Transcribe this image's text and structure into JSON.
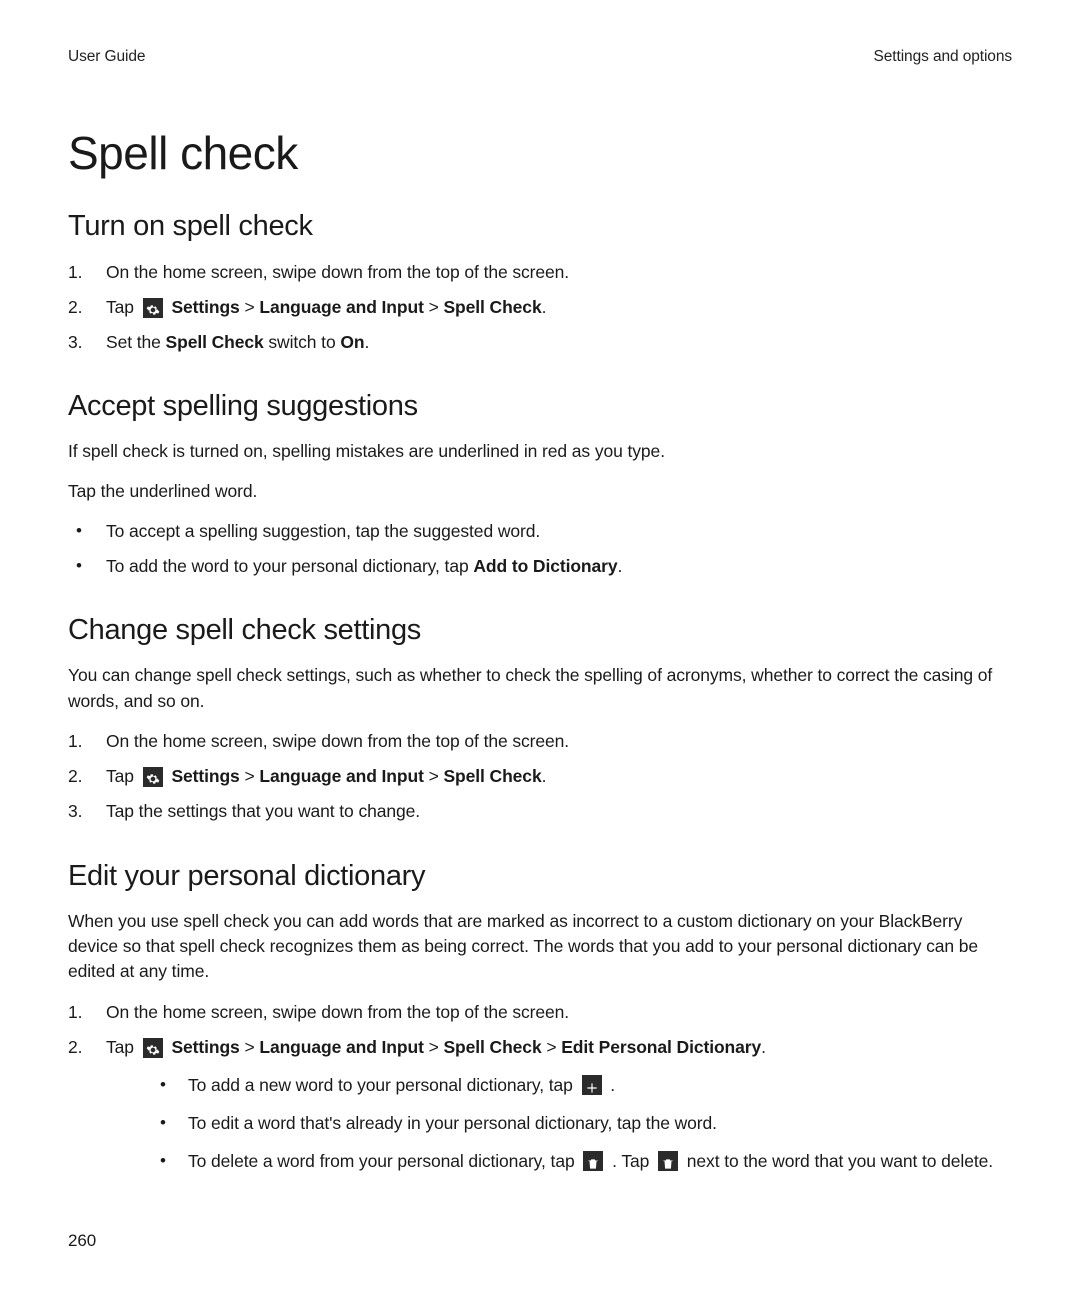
{
  "header": {
    "left": "User Guide",
    "right": "Settings and options"
  },
  "title": "Spell check",
  "page_number": "260",
  "sec1": {
    "heading": "Turn on spell check",
    "steps": {
      "s1": "On the home screen, swipe down from the top of the screen.",
      "s2": {
        "tap": "Tap ",
        "settings": "Settings",
        "gt1": " > ",
        "lai": "Language and Input",
        "gt2": " > ",
        "sc": "Spell Check",
        "dot": "."
      },
      "s3": {
        "a": "Set the ",
        "b": "Spell Check",
        "c": " switch to ",
        "d": "On",
        "e": "."
      }
    }
  },
  "sec2": {
    "heading": "Accept spelling suggestions",
    "p1": "If spell check is turned on, spelling mistakes are underlined in red as you type.",
    "p2": "Tap the underlined word.",
    "bul": {
      "b1": "To accept a spelling suggestion, tap the suggested word.",
      "b2": {
        "a": "To add the word to your personal dictionary, tap ",
        "b": "Add to Dictionary",
        "c": "."
      }
    }
  },
  "sec3": {
    "heading": "Change spell check settings",
    "p1": "You can change spell check settings, such as whether to check the spelling of acronyms, whether to correct the casing of words, and so on.",
    "steps": {
      "s1": "On the home screen, swipe down from the top of the screen.",
      "s2": {
        "tap": "Tap ",
        "settings": "Settings",
        "gt1": " > ",
        "lai": "Language and Input",
        "gt2": " > ",
        "sc": "Spell Check",
        "dot": "."
      },
      "s3": "Tap the settings that you want to change."
    }
  },
  "sec4": {
    "heading": "Edit your personal dictionary",
    "p1": "When you use spell check you can add words that are marked as incorrect to a custom dictionary on your BlackBerry device so that spell check recognizes them as being correct. The words that you add to your personal dictionary can be edited at any time.",
    "steps": {
      "s1": "On the home screen, swipe down from the top of the screen.",
      "s2": {
        "tap": "Tap ",
        "settings": "Settings",
        "gt1": " > ",
        "lai": "Language and Input",
        "gt2": " > ",
        "sc": "Spell Check",
        "gt3": " > ",
        "epd": "Edit Personal Dictionary",
        "dot": "."
      }
    },
    "sub": {
      "b1": {
        "a": "To add a new word to your personal dictionary, tap ",
        "b": " ."
      },
      "b2": " To edit a word that's already in your personal dictionary, tap the word.",
      "b3": {
        "a": "To delete a word from your personal dictionary, tap ",
        "b": " . Tap ",
        "c": "  next to the word that you want to delete."
      }
    }
  }
}
